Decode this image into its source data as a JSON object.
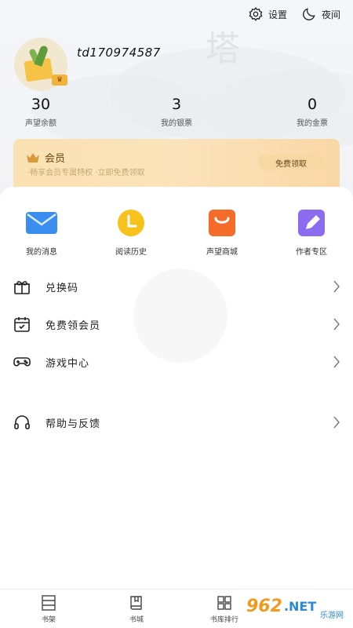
{
  "header": {
    "settings_label": "设置",
    "night_label": "夜间",
    "username": "td170974587"
  },
  "stats": [
    {
      "value": "30",
      "label": "声望余额"
    },
    {
      "value": "3",
      "label": "我的银票"
    },
    {
      "value": "0",
      "label": "我的金票"
    }
  ],
  "vip": {
    "title": "会员",
    "subtitle": "·畅享会员专属特权 ·立即免费领取",
    "button": "免费领取"
  },
  "quick_actions": [
    {
      "label": "我的消息",
      "icon": "mail-icon",
      "color": "#3b8ef0"
    },
    {
      "label": "阅读历史",
      "icon": "history-icon",
      "color": "#f7c21c"
    },
    {
      "label": "声望商城",
      "icon": "shop-bag-icon",
      "color": "#f46b2a"
    },
    {
      "label": "作者专区",
      "icon": "author-edit-icon",
      "color": "#8b6cf0"
    }
  ],
  "menu": [
    {
      "label": "兑换码",
      "icon": "gift-icon"
    },
    {
      "label": "免费领会员",
      "icon": "calendar-check-icon"
    },
    {
      "label": "游戏中心",
      "icon": "gamepad-icon"
    },
    {
      "label": "帮助与反馈",
      "icon": "headphones-icon"
    }
  ],
  "tabs": [
    {
      "label": "书架",
      "icon": "bookshelf-icon"
    },
    {
      "label": "书城",
      "icon": "book-icon"
    },
    {
      "label": "书库排行",
      "icon": "grid-icon"
    }
  ],
  "brand": {
    "num": "962",
    "net": ".NET",
    "cn": "乐游网"
  }
}
